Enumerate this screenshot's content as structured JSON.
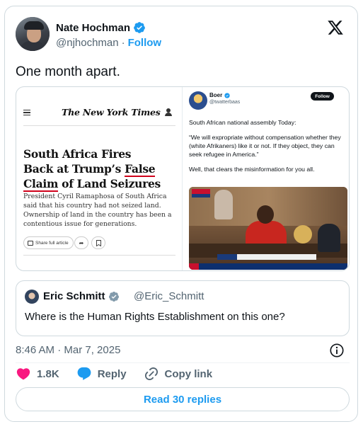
{
  "author": {
    "display_name": "Nate Hochman",
    "handle": "@njhochman",
    "separator": "·",
    "follow_label": "Follow"
  },
  "tweet": {
    "text": "One month apart.",
    "timestamp": "8:46 AM · Mar 7, 2025"
  },
  "media": {
    "left": {
      "masthead": "The New York Times",
      "headline_parts": [
        "South Africa Fires",
        "Back at Trump’s ",
        "False",
        "Claim",
        " of Land Seizures"
      ],
      "summary": "President Cyril Ramaphosa of South Africa said that his country had not seized land. Ownership of land in the country has been a contentious issue for generations.",
      "share_label": "Share full article",
      "highlight_color": "#d0021b"
    },
    "right": {
      "name": "Boer",
      "handle": "@twatterbaas",
      "follow_label": "Follow",
      "paragraphs": [
        "South African national assembly Today:",
        "“We will expropriate without compensation whether they (white Afrikaners) like it or not. If they object, they can seek refugee in America.”",
        "Well, that clears the misinformation for you all."
      ]
    }
  },
  "quote": {
    "display_name": "Eric Schmitt",
    "handle": "@Eric_Schmitt",
    "text": "Where is the Human Rights Establishment on this one?"
  },
  "actions": {
    "like_count": "1.8K",
    "reply_label": "Reply",
    "copy_label": "Copy link",
    "read_replies_label": "Read 30 replies"
  },
  "colors": {
    "accent": "#1d9bf0",
    "like": "#f91880",
    "verified_gray": "#829aab"
  }
}
